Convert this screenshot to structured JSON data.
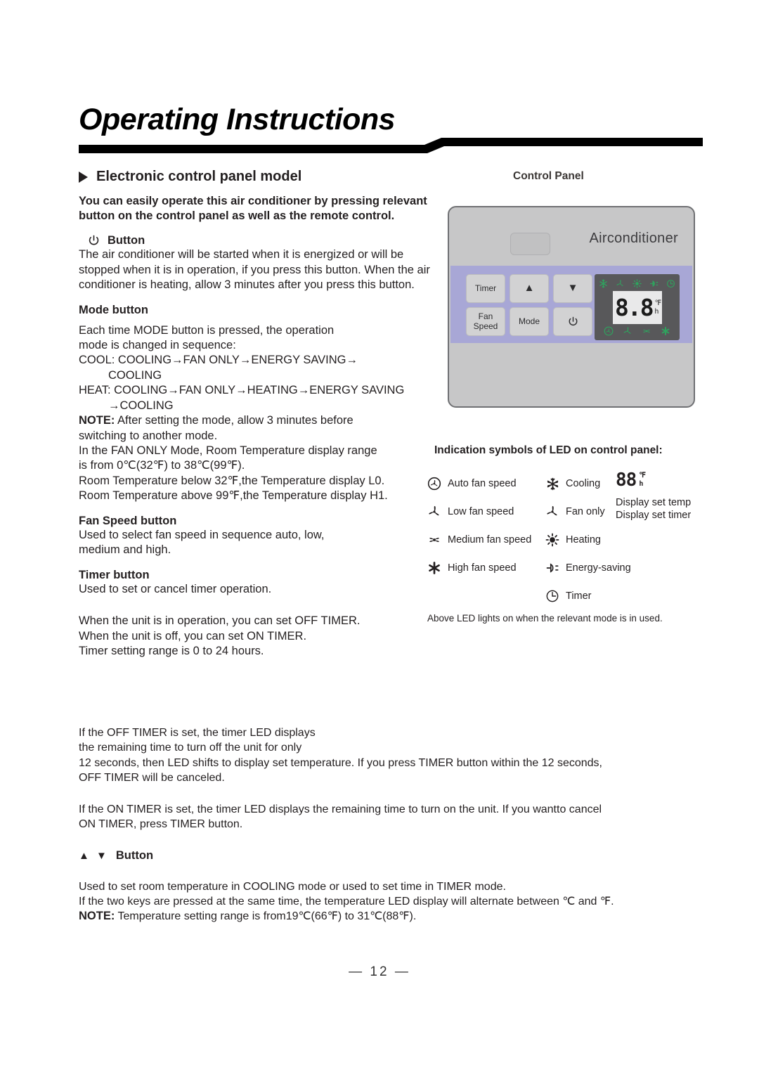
{
  "header": {
    "title": "Operating Instructions"
  },
  "section": {
    "heading": "Electronic  control panel model"
  },
  "left": {
    "intro": "You can easily operate this air conditioner by pressing relevant button  on the control panel as well as the remote control.",
    "power_button_icon": "power-icon",
    "power_button_heading": "Button",
    "power_body": "The air conditioner will be started when it is energized or will be stopped when it is in operation, if you press this button. When the air conditioner is heating, allow  3 minutes after you press this button.",
    "mode_heading": "Mode button",
    "mode_line1": "Each time  MODE button is pressed, the operation",
    "mode_line2": "mode is changed in sequence:",
    "mode_cool": "COOL: COOLING→FAN ONLY→ENERGY SAVING→",
    "mode_cool_cont": "COOLING",
    "mode_heat": "HEAT: COOLING→FAN ONLY→HEATING→ENERGY SAVING",
    "mode_heat_cont": "→COOLING",
    "note_mode_label": "NOTE:",
    "note_mode_text": " After setting the mode, allow 3 minutes before",
    "note_mode_cont": "switching to another mode.",
    "fanonly_line1": "In the FAN ONLY Mode, Room Temperature display range",
    "fanonly_line2": "is from 0℃(32℉) to 38℃(99℉).",
    "below_line": "Room Temperature below 32℉,the Temperature display L0.",
    "above_line": "Room Temperature above 99℉,the Temperature display H1.",
    "fanspeed_heading": "Fan Speed  button",
    "fanspeed_line1": "Used to select fan speed in sequence auto, low,",
    "fanspeed_line2": "medium and high.",
    "timer_heading": "Timer button",
    "timer_body": "Used to set or cancel timer operation."
  },
  "wide": {
    "timer_l1": "When the unit is in operation, you can set OFF TIMER.",
    "timer_l2": "When the unit is off, you can set ON TIMER.",
    "timer_l3": "Timer setting range is 0 to 24 hours.",
    "off_l1": "If the OFF TIMER is set, the timer LED displays",
    "off_l2": "the remaining time to turn off the unit for only",
    "off_l3": "12 seconds, then LED shifts to display set temperature. If you press TIMER button within the 12 seconds,",
    "off_l4": "OFF TIMER will be canceled.",
    "on_l1": "If the ON TIMER is set, the timer LED displays the remaining time to turn on the unit. If you wantto cancel",
    "on_l2": "ON TIMER, press TIMER button.",
    "updown_arrows": "▲ ▼",
    "updown_heading": "Button",
    "updown_l1": "Used to set room temperature in COOLING mode or used to set time in TIMER mode.",
    "updown_l2": "If the two keys are pressed at the same time, the temperature LED display will alternate between ℃ and  ℉.",
    "updown_note_label": "NOTE:",
    "updown_note_text": " Temperature setting range is from19℃(66℉) to 31℃(88℉)."
  },
  "right": {
    "control_panel_label": "Control Panel",
    "panel": {
      "brand": "Airconditioner",
      "buttons": [
        {
          "label": "Timer",
          "name": "timer-button"
        },
        {
          "label": "▲",
          "name": "temp-up-button"
        },
        {
          "label": "▼",
          "name": "temp-down-button"
        },
        {
          "label": "Fan\nSpeed",
          "name": "fan-speed-button"
        },
        {
          "label": "Mode",
          "name": "mode-button"
        },
        {
          "label": "⏻",
          "name": "power-button"
        }
      ],
      "lcd_value": "8.8",
      "lcd_unit_top": "℉",
      "lcd_unit_bottom": "h",
      "led_top_icons": [
        "cooling-icon",
        "fan-only-icon",
        "heating-icon",
        "energy-saving-icon",
        "timer-icon"
      ],
      "led_bottom_icons": [
        "auto-fan-icon",
        "low-fan-icon",
        "medium-fan-icon",
        "high-fan-icon"
      ],
      "led_color": "#2fa35e"
    },
    "legend": {
      "title": "Indication symbols of LED on control panel:",
      "column1": [
        {
          "icon": "auto-fan-icon",
          "label": "Auto fan speed"
        },
        {
          "icon": "low-fan-icon",
          "label": "Low fan speed"
        },
        {
          "icon": "medium-fan-icon",
          "label": "Medium fan speed"
        },
        {
          "icon": "high-fan-icon",
          "label": "High fan speed"
        }
      ],
      "column2": [
        {
          "icon": "cooling-icon",
          "label": "Cooling"
        },
        {
          "icon": "fan-only-icon",
          "label": "Fan only"
        },
        {
          "icon": "heating-icon",
          "label": "Heating"
        },
        {
          "icon": "energy-saving-icon",
          "label": "Energy-saving"
        },
        {
          "icon": "timer-icon",
          "label": "Timer"
        }
      ],
      "display": {
        "digits": "88",
        "unit_top": "℉",
        "unit_bottom": "h",
        "caption_line1": "Display set temp",
        "caption_line2": "Display set timer"
      },
      "footnote": "Above LED lights on when the relevant mode is in used."
    }
  },
  "footer": {
    "page_number": "—  12  —"
  }
}
